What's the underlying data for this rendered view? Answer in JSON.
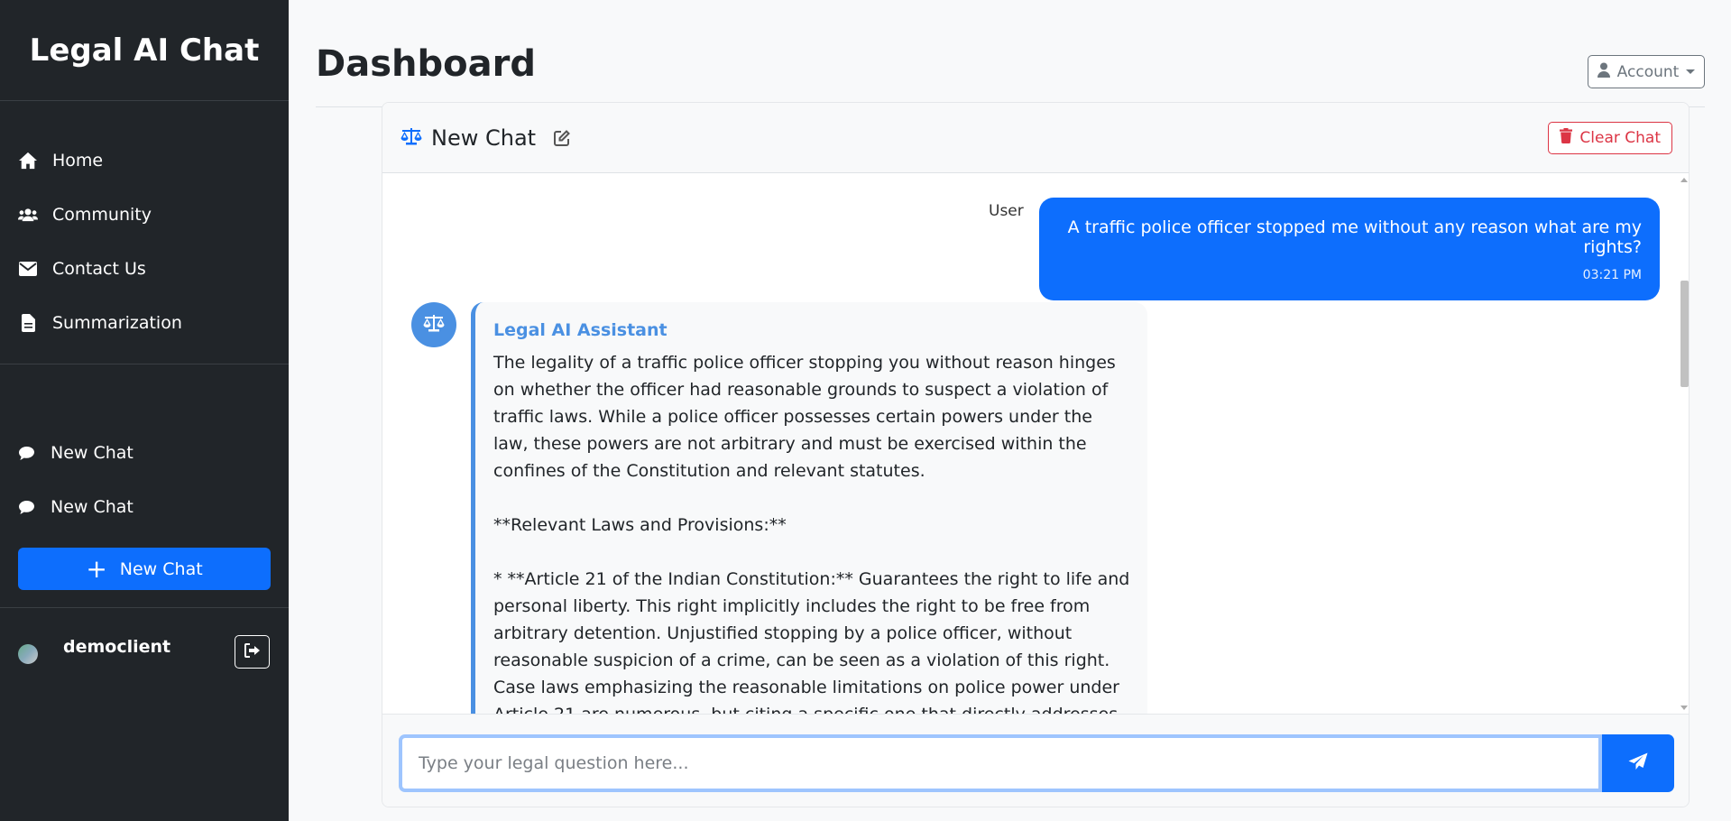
{
  "sidebar": {
    "brand": "Legal AI Chat",
    "nav": [
      {
        "label": "Home",
        "icon": "home-icon"
      },
      {
        "label": "Community",
        "icon": "users-icon"
      },
      {
        "label": "Contact Us",
        "icon": "envelope-icon"
      },
      {
        "label": "Summarization",
        "icon": "document-icon"
      }
    ],
    "chats": [
      {
        "label": "New Chat",
        "icon": "chat-bubble-icon"
      },
      {
        "label": "New Chat",
        "icon": "chat-bubble-icon"
      }
    ],
    "new_chat_button": "New Chat",
    "username": "democlient"
  },
  "header": {
    "title": "Dashboard",
    "account_label": "Account"
  },
  "chat": {
    "title": "New Chat",
    "clear_label": "Clear Chat",
    "user_message": {
      "avatar_alt": "User",
      "text": "A traffic police officer stopped me without any reason what are my rights?",
      "time": "03:21 PM"
    },
    "ai_message": {
      "sender": "Legal AI Assistant",
      "text": "The legality of a traffic police officer stopping you without reason hinges on whether the officer had reasonable grounds to suspect a violation of traffic laws. While a police officer possesses certain powers under the law, these powers are not arbitrary and must be exercised within the confines of the Constitution and relevant statutes.\n\n**Relevant Laws and Provisions:**\n\n* **Article 21 of the Indian Constitution:** Guarantees the right to life and personal liberty. This right implicitly includes the right to be free from arbitrary detention. Unjustified stopping by a police officer, without reasonable suspicion of a crime, can be seen as a violation of this right. Case laws emphasizing the reasonable limitations on police power under Article 21 are numerous, but citing a specific one that directly addresses this scenario of arbitrary"
    },
    "input_placeholder": "Type your legal question here..."
  },
  "colors": {
    "sidebar_bg": "#212529",
    "primary": "#0d6efd",
    "ai_accent": "#4a90e2",
    "danger": "#dc3545"
  }
}
